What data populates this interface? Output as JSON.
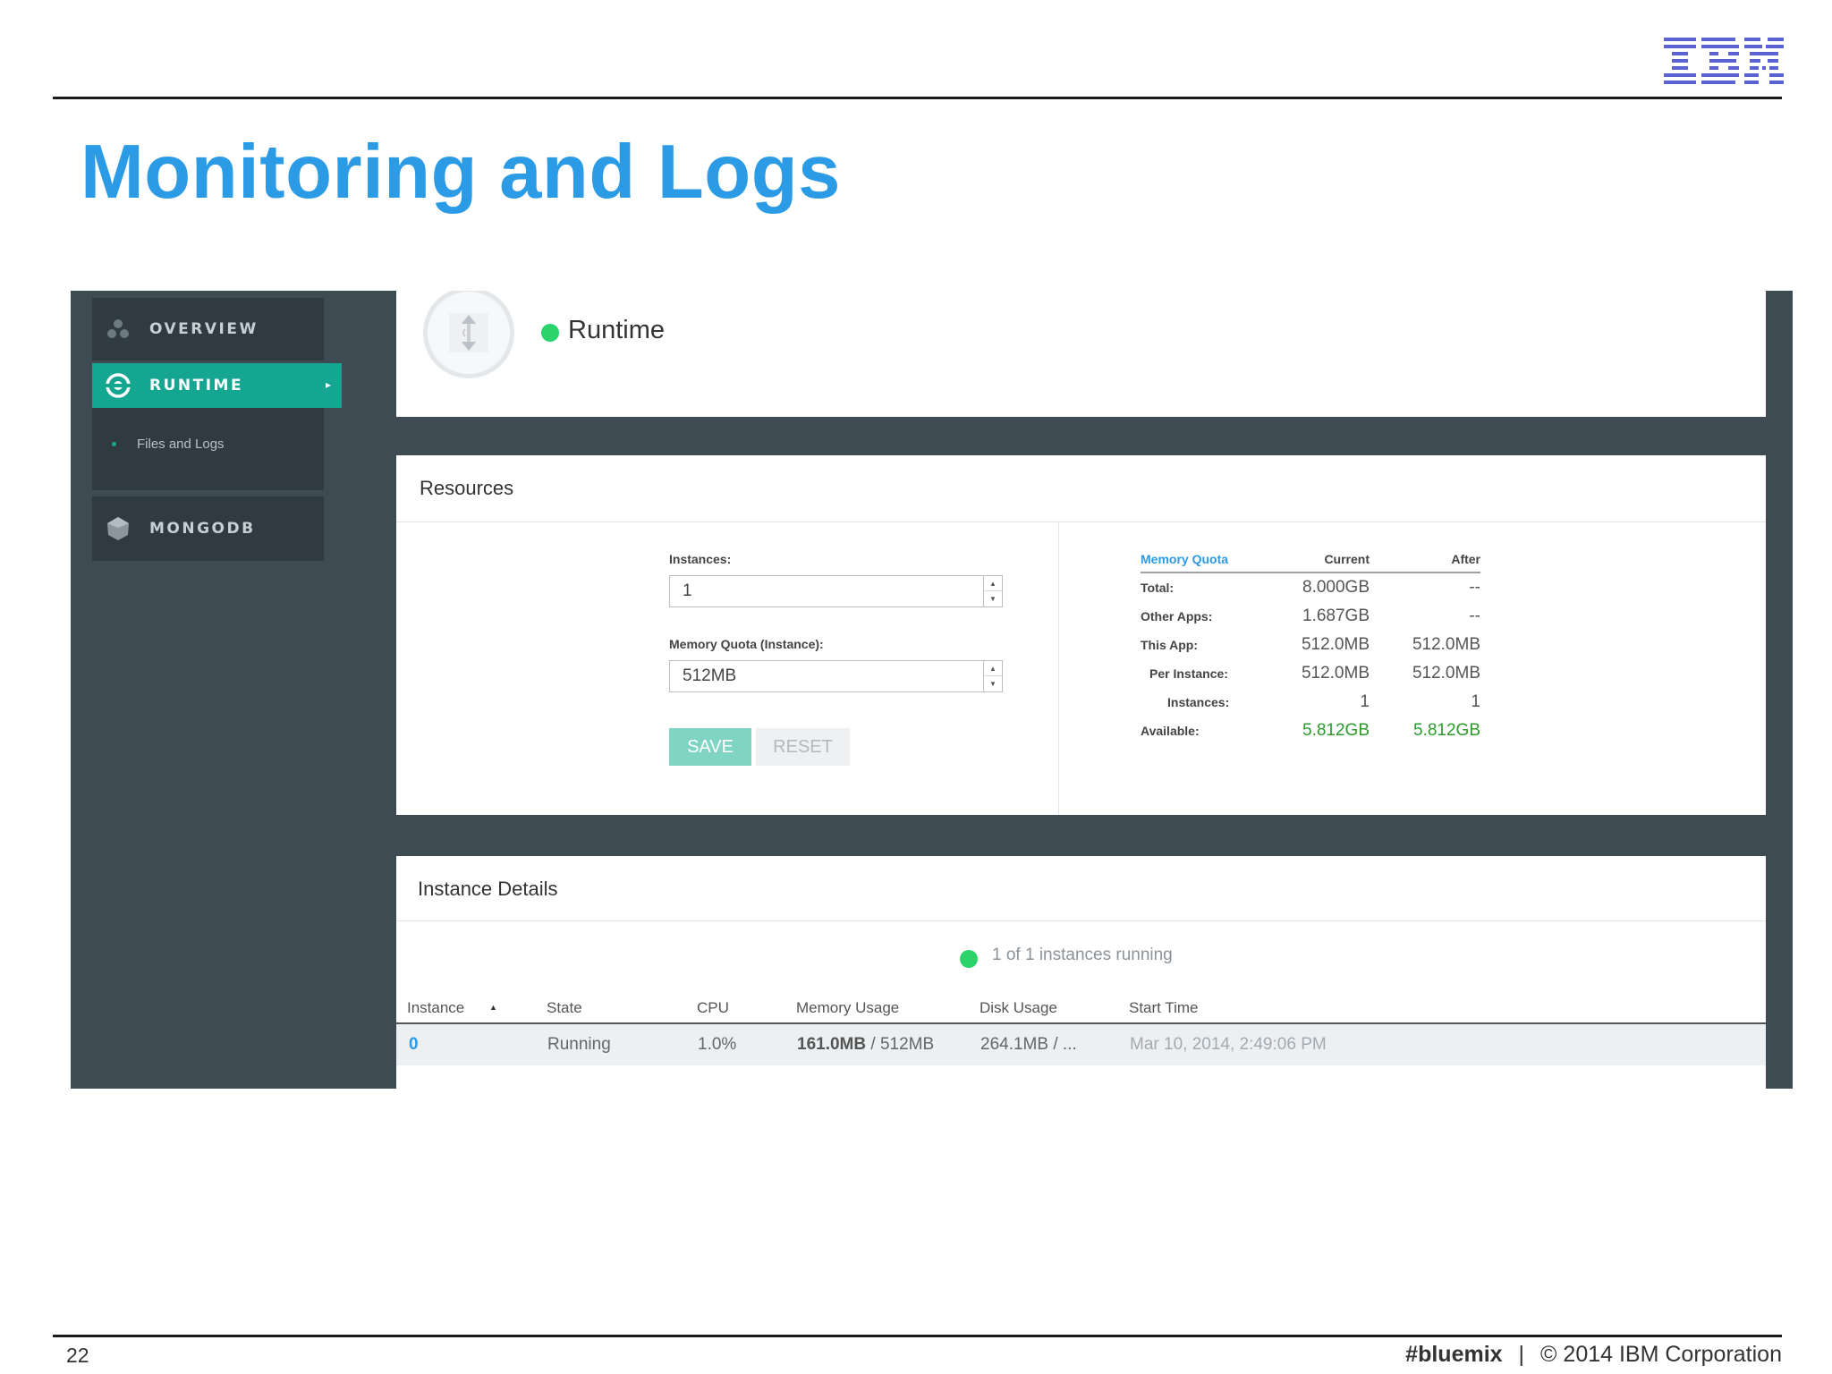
{
  "slide": {
    "logo": "IBM",
    "title": "Monitoring and Logs",
    "page_number": "22",
    "footer_tag": "#bluemix",
    "footer_separator": "|",
    "footer_copyright": "© 2014 IBM Corporation"
  },
  "sidebar": {
    "items": [
      {
        "label": "OVERVIEW",
        "icon": "overview-icon"
      },
      {
        "label": "RUNTIME",
        "icon": "runtime-icon",
        "active": true
      },
      {
        "label": "Files and Logs",
        "icon": "bullet-icon"
      },
      {
        "label": "MONGODB",
        "icon": "mongodb-icon"
      }
    ]
  },
  "runtime": {
    "title": "Runtime",
    "status_color": "#2bd36b"
  },
  "resources": {
    "title": "Resources",
    "instances_label": "Instances:",
    "instances_value": "1",
    "memory_label": "Memory Quota (Instance):",
    "memory_value": "512MB",
    "save_label": "SAVE",
    "reset_label": "RESET",
    "quota_table": {
      "headers": [
        "Memory Quota",
        "Current",
        "After"
      ],
      "rows": [
        {
          "key": "Total:",
          "current": "8.000GB",
          "after": "--"
        },
        {
          "key": "Other Apps:",
          "current": "1.687GB",
          "after": "--"
        },
        {
          "key": "This App:",
          "current": "512.0MB",
          "after": "512.0MB"
        },
        {
          "key": "Per Instance:",
          "current": "512.0MB",
          "after": "512.0MB"
        },
        {
          "key": "Instances:",
          "current": "1",
          "after": "1"
        },
        {
          "key": "Available:",
          "current": "5.812GB",
          "after": "5.812GB"
        }
      ]
    }
  },
  "instances": {
    "title": "Instance Details",
    "running_text": "1 of 1 instances running",
    "columns": [
      "Instance",
      "State",
      "CPU",
      "Memory Usage",
      "Disk Usage",
      "Start Time"
    ],
    "row": {
      "instance": "0",
      "state": "Running",
      "cpu": "1.0%",
      "memory_used": "161.0MB",
      "memory_total": " / 512MB",
      "disk": "264.1MB / ...",
      "start_time": "Mar 10, 2014, 2:49:06 PM"
    }
  },
  "colors": {
    "accent_blue": "#2b9be6",
    "teal": "#14a690",
    "green": "#2c9a2c",
    "sidebar_bg": "#3e4b53"
  }
}
